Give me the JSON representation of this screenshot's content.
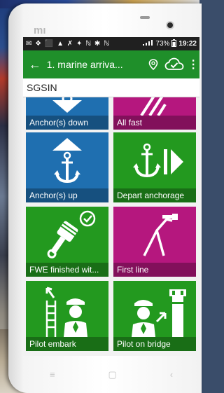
{
  "status_bar": {
    "left_icons": "✉ ❖ ⬛ ▲ ✗ ✦ ℕ ✱ ℕ",
    "battery": "73%",
    "time": "19:22"
  },
  "app_bar": {
    "back": "←",
    "title": "1. marine arriva...",
    "menu": "⋮"
  },
  "port": {
    "code": "SGSIN"
  },
  "tiles": [
    {
      "label": "Anchor(s) down",
      "color": "#1f6fb0"
    },
    {
      "label": "All fast",
      "color": "#b5177e"
    },
    {
      "label": "Anchor(s) up",
      "color": "#1f6fb0"
    },
    {
      "label": "Depart anchorage",
      "color": "#23991f"
    },
    {
      "label": "FWE finished wit...",
      "color": "#23991f"
    },
    {
      "label": "First line",
      "color": "#b5177e"
    },
    {
      "label": "Pilot embark",
      "color": "#23991f"
    },
    {
      "label": "Pilot on bridge",
      "color": "#23991f"
    }
  ],
  "nav": {
    "menu": "≡",
    "home": "▢",
    "back": "‹"
  }
}
